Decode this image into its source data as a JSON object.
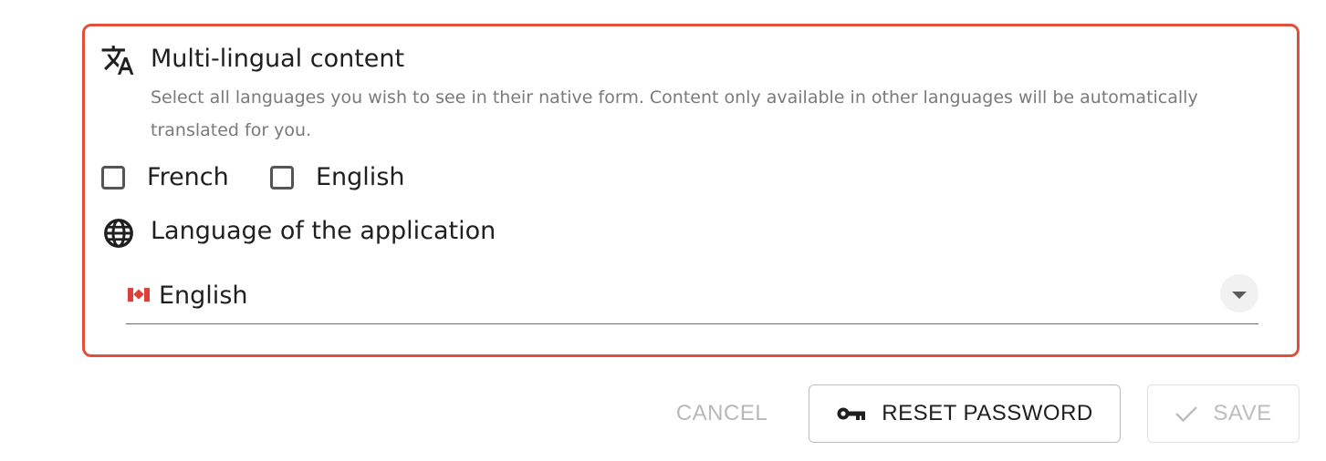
{
  "multilingual": {
    "icon": "translate-icon",
    "title": "Multi-lingual content",
    "description": "Select all languages you wish to see in their native form. Content only available in other languages will be automatically translated for you.",
    "options": [
      {
        "label": "French",
        "checked": false
      },
      {
        "label": "English",
        "checked": false
      }
    ]
  },
  "app_language": {
    "icon": "globe-icon",
    "title": "Language of the application",
    "flag_icon": "canada-flag-icon",
    "selected": "English"
  },
  "colors": {
    "highlight_border": "#e0503c",
    "disabled_text": "#b8b8b8"
  },
  "actions": {
    "cancel_label": "CANCEL",
    "reset_label": "RESET PASSWORD",
    "reset_icon": "key-icon",
    "save_label": "SAVE",
    "save_icon": "check-icon"
  }
}
